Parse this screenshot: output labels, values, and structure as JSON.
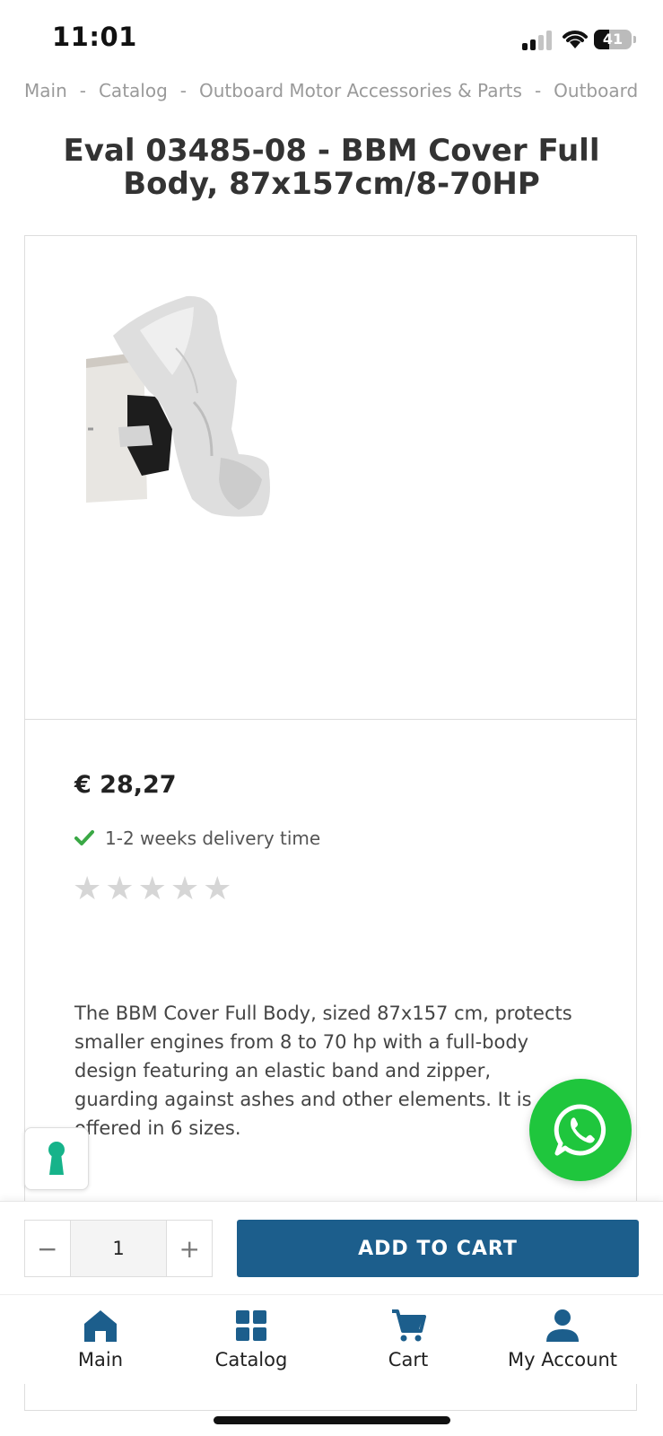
{
  "status_bar": {
    "time": "11:01",
    "battery": "41",
    "battery_level": 0.41
  },
  "breadcrumb": [
    "Main",
    "Catalog",
    "Outboard Motor Accessories & Parts",
    "Outboard"
  ],
  "breadcrumb_separator": "-",
  "product": {
    "title": "Eval 03485-08 - BBM Cover Full Body, 87x157cm/8-70HP",
    "price": "€ 28,27",
    "delivery": "1-2 weeks delivery time",
    "rating": {
      "value": 0,
      "max": 5
    },
    "description": "The BBM Cover Full Body, sized 87x157 cm, protects smaller engines from 8 to 70 hp with a full-body design featuring an elastic band and zipper, guarding against ashes and other elements. It is offered in 6 sizes."
  },
  "purchase": {
    "quantity": "1",
    "minus": "−",
    "plus": "+",
    "add_to_cart": "ADD TO CART"
  },
  "nav": {
    "main": "Main",
    "catalog": "Catalog",
    "cart": "Cart",
    "account": "My Account"
  },
  "colors": {
    "accent": "#1c5e8c",
    "whatsapp": "#1fc63d",
    "check": "#3aa845",
    "key": "#16b38a"
  },
  "icons": [
    "signal-icon",
    "wifi-icon",
    "battery-icon",
    "check-icon",
    "star-icon",
    "whatsapp-icon",
    "keyhole-icon",
    "home-icon",
    "grid-icon",
    "cart-icon",
    "user-icon"
  ]
}
